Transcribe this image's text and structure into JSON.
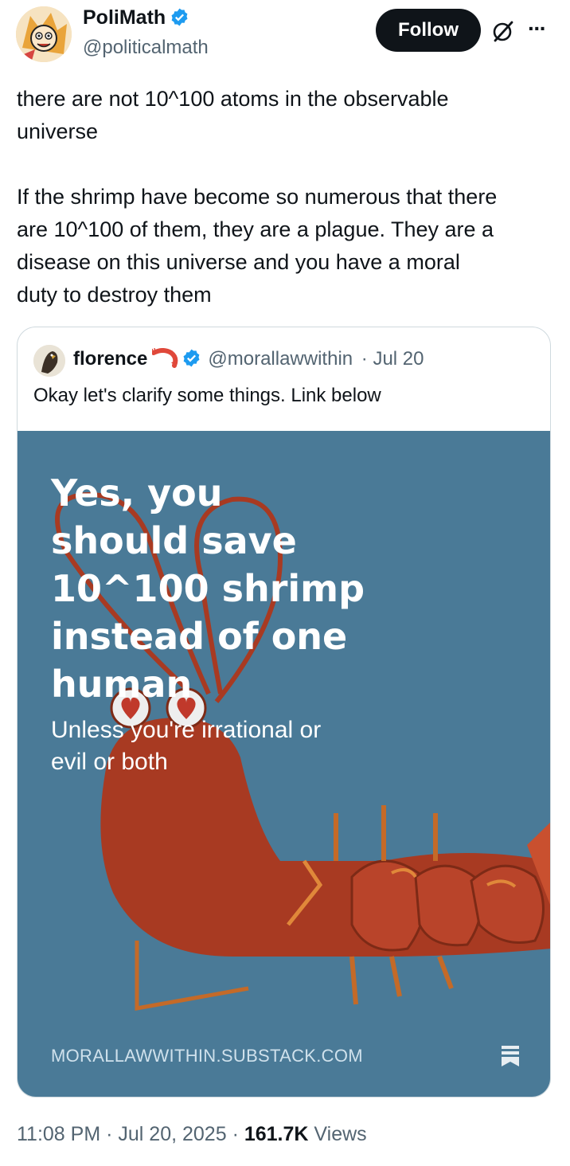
{
  "author": {
    "display_name": "PoliMath",
    "handle": "@politicalmath"
  },
  "actions": {
    "follow_label": "Follow",
    "more_label": "···"
  },
  "tweet": {
    "text": "there are not 10^100 atoms in the observable\nuniverse\n\nIf the shrimp have become so numerous that there\nare 10^100 of them, they are a plague. They are a\ndisease on this universe and you have a moral\nduty to destroy them"
  },
  "quote": {
    "display_name": "florence",
    "handle": "@morallawwithin",
    "date": "· Jul 20",
    "text": "Okay let's clarify some things. Link below",
    "card": {
      "headline": "Yes, you\nshould save\n10^100 shrimp\ninstead of one\nhuman",
      "subheadline": "Unless you're irrational or\nevil or both",
      "domain": "MORALLAWWITHIN.SUBSTACK.COM",
      "bg_color": "#4a7a97",
      "shrimp_color": "#a83a22"
    }
  },
  "meta": {
    "time": "11:08 PM",
    "date": "Jul 20, 2025",
    "views_count": "161.7K",
    "views_label": "Views"
  },
  "colors": {
    "verified": "#1d9bf0",
    "secondary_text": "#536471"
  }
}
